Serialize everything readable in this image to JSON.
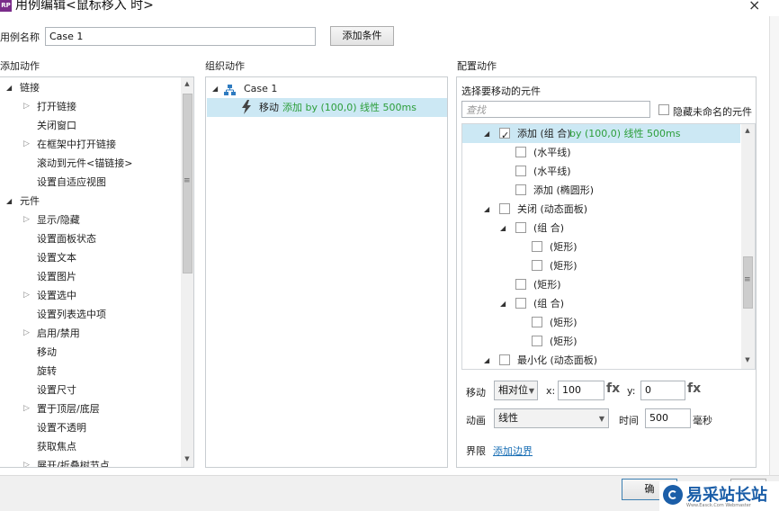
{
  "window": {
    "logo": "RP",
    "title": "用例编辑<鼠标移入 时>",
    "close": "×"
  },
  "case_name": {
    "label": "用例名称",
    "value": "Case 1",
    "add_condition": "添加条件"
  },
  "headers": {
    "add_action": "添加动作",
    "organize_action": "组织动作",
    "configure_action": "配置动作"
  },
  "add_action_tree": [
    {
      "label": "链接",
      "level": 0,
      "state": "open"
    },
    {
      "label": "打开链接",
      "level": 1,
      "state": "closed"
    },
    {
      "label": "关闭窗口",
      "level": 1,
      "state": "leaf"
    },
    {
      "label": "在框架中打开链接",
      "level": 1,
      "state": "closed"
    },
    {
      "label": "滚动到元件<锚链接>",
      "level": 1,
      "state": "leaf"
    },
    {
      "label": "设置自适应视图",
      "level": 1,
      "state": "leaf"
    },
    {
      "label": "元件",
      "level": 0,
      "state": "open"
    },
    {
      "label": "显示/隐藏",
      "level": 1,
      "state": "closed"
    },
    {
      "label": "设置面板状态",
      "level": 1,
      "state": "leaf"
    },
    {
      "label": "设置文本",
      "level": 1,
      "state": "leaf"
    },
    {
      "label": "设置图片",
      "level": 1,
      "state": "leaf"
    },
    {
      "label": "设置选中",
      "level": 1,
      "state": "closed"
    },
    {
      "label": "设置列表选中项",
      "level": 1,
      "state": "leaf"
    },
    {
      "label": "启用/禁用",
      "level": 1,
      "state": "closed"
    },
    {
      "label": "移动",
      "level": 1,
      "state": "leaf"
    },
    {
      "label": "旋转",
      "level": 1,
      "state": "leaf"
    },
    {
      "label": "设置尺寸",
      "level": 1,
      "state": "leaf"
    },
    {
      "label": "置于顶层/底层",
      "level": 1,
      "state": "closed"
    },
    {
      "label": "设置不透明",
      "level": 1,
      "state": "leaf"
    },
    {
      "label": "获取焦点",
      "level": 1,
      "state": "leaf"
    },
    {
      "label": "展开/折叠树节点",
      "level": 1,
      "state": "closed"
    }
  ],
  "organize": {
    "case_label": "Case 1",
    "action_verb": "移动",
    "action_detail": "添加 by (100,0) 线性 500ms"
  },
  "configure": {
    "select_label": "选择要移动的元件",
    "search_placeholder": "查找",
    "hide_unnamed": "隐藏未命名的元件",
    "widgets": [
      {
        "label": "添加 (组 合)",
        "detail": " by (100,0) 线性 500ms",
        "level": 0,
        "checked": true,
        "tri": true,
        "selected": true
      },
      {
        "label": "(水平线)",
        "detail": "",
        "level": 1,
        "checked": false,
        "tri": false,
        "selected": false
      },
      {
        "label": "(水平线)",
        "detail": "",
        "level": 1,
        "checked": false,
        "tri": false,
        "selected": false
      },
      {
        "label": "添加 (椭圆形)",
        "detail": "",
        "level": 1,
        "checked": false,
        "tri": false,
        "selected": false
      },
      {
        "label": "关闭 (动态面板)",
        "detail": "",
        "level": 0,
        "checked": false,
        "tri": true,
        "selected": false
      },
      {
        "label": "(组 合)",
        "detail": "",
        "level": 1,
        "checked": false,
        "tri": true,
        "selected": false
      },
      {
        "label": "(矩形)",
        "detail": "",
        "level": 2,
        "checked": false,
        "tri": false,
        "selected": false
      },
      {
        "label": "(矩形)",
        "detail": "",
        "level": 2,
        "checked": false,
        "tri": false,
        "selected": false
      },
      {
        "label": "(矩形)",
        "detail": "",
        "level": 1,
        "checked": false,
        "tri": false,
        "selected": false
      },
      {
        "label": "(组 合)",
        "detail": "",
        "level": 1,
        "checked": false,
        "tri": true,
        "selected": false
      },
      {
        "label": "(矩形)",
        "detail": "",
        "level": 2,
        "checked": false,
        "tri": false,
        "selected": false
      },
      {
        "label": "(矩形)",
        "detail": "",
        "level": 2,
        "checked": false,
        "tri": false,
        "selected": false
      },
      {
        "label": "最小化 (动态面板)",
        "detail": "",
        "level": 0,
        "checked": false,
        "tri": true,
        "selected": false
      }
    ],
    "move_label": "移动",
    "move_mode": "相对位",
    "x_label": "x:",
    "x_value": "100",
    "y_label": "y:",
    "y_value": "0",
    "fx": "fx",
    "anim_label": "动画",
    "anim_value": "线性",
    "time_label": "时间",
    "time_value": "500",
    "time_unit": "毫秒",
    "bounds_label": "界限",
    "bounds_link": "添加边界"
  },
  "footer": {
    "ok": "确"
  },
  "watermark": {
    "text": "易采站长站",
    "sub": "Www.Easck.Com Webmaster"
  },
  "colors": {
    "selection": "#cce8f4",
    "link": "#1a6fb5",
    "green": "#2c9e3a"
  }
}
